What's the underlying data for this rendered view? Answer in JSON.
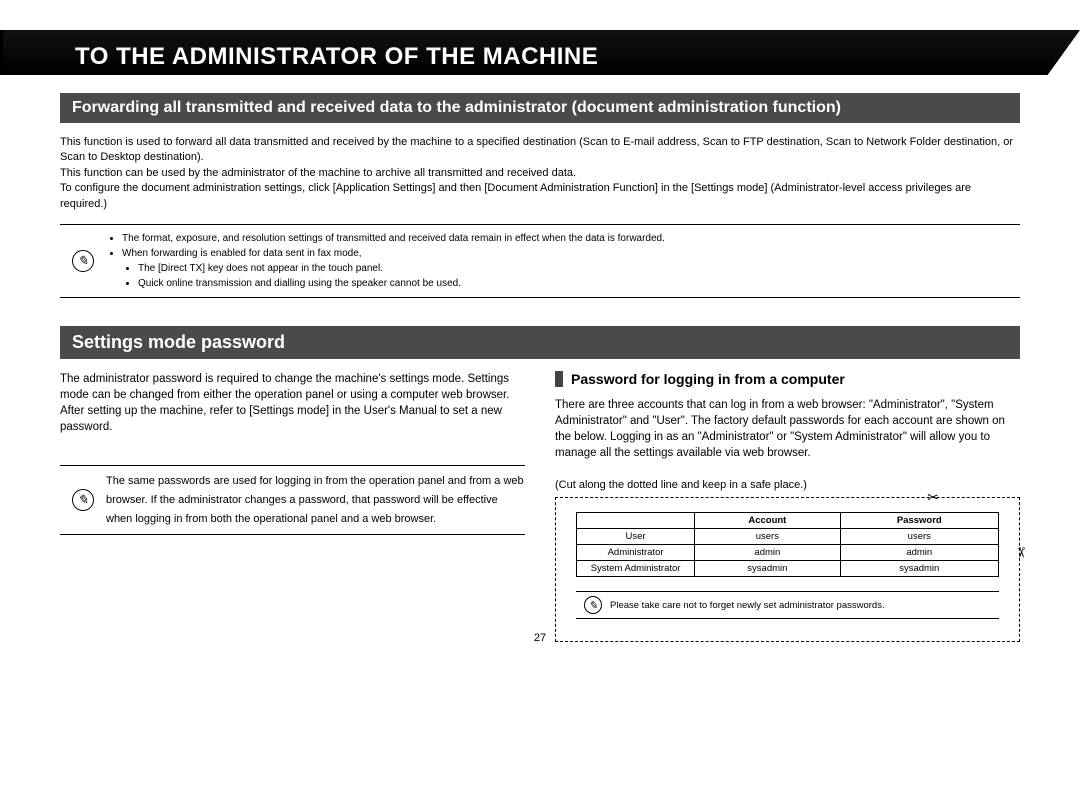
{
  "banner": {
    "title": "To the Administrator of the Machine"
  },
  "forwarding": {
    "header": "Forwarding all transmitted and received data to the administrator (document administration function)",
    "p1": "This function is used to forward all data transmitted and received by the machine to a specified destination (Scan to E-mail address, Scan to FTP destination, Scan to Network Folder destination, or Scan to Desktop destination).",
    "p2": "This function can be used by the administrator of the machine to archive all transmitted and received data.",
    "p3": "To configure the document administration settings, click [Application Settings] and then [Document Administration Function] in the [Settings mode] (Administrator-level access privileges are required.)",
    "notes": {
      "n1": "The format, exposure, and resolution settings of transmitted and received data remain in effect when the data is forwarded.",
      "n2": "When forwarding is enabled for data sent in fax mode,",
      "n2a": "The [Direct TX] key does not appear in the touch panel.",
      "n2b": "Quick online transmission and dialling using the speaker cannot be used."
    }
  },
  "settings": {
    "header": "Settings mode password",
    "left": {
      "p1": "The administrator password is required to change the machine's settings mode. Settings mode can be changed from either the operation panel or using a computer web browser. After setting up the machine, refer to [Settings mode] in the User's Manual to set a new password.",
      "note": "The same passwords are used for logging in from the operation panel and from a web browser. If the administrator changes a password, that password will be effective when logging in from both the operational panel and a web browser."
    },
    "right": {
      "heading": "Password for logging in from a computer",
      "p1": "There are three accounts that can log in from a web browser: \"Administrator\", \"System Administrator\" and \"User\". The factory default passwords for each account are shown on the below. Logging in as an \"Administrator\" or \"System Administrator\" will allow you to manage all the settings available via web browser.",
      "cut_label": "(Cut along the dotted line and keep in a safe place.)",
      "table": {
        "h0": "",
        "h1": "Account",
        "h2": "Password",
        "rows": [
          {
            "name": "User",
            "account": "users",
            "password": "users"
          },
          {
            "name": "Administrator",
            "account": "admin",
            "password": "admin"
          },
          {
            "name": "System Administrator",
            "account": "sysadmin",
            "password": "sysadmin"
          }
        ]
      },
      "cut_note": "Please take care not to forget newly set administrator passwords."
    }
  },
  "page_number": "27",
  "icons": {
    "pencil_glyph": "✎",
    "scissors_glyph": "✂"
  }
}
